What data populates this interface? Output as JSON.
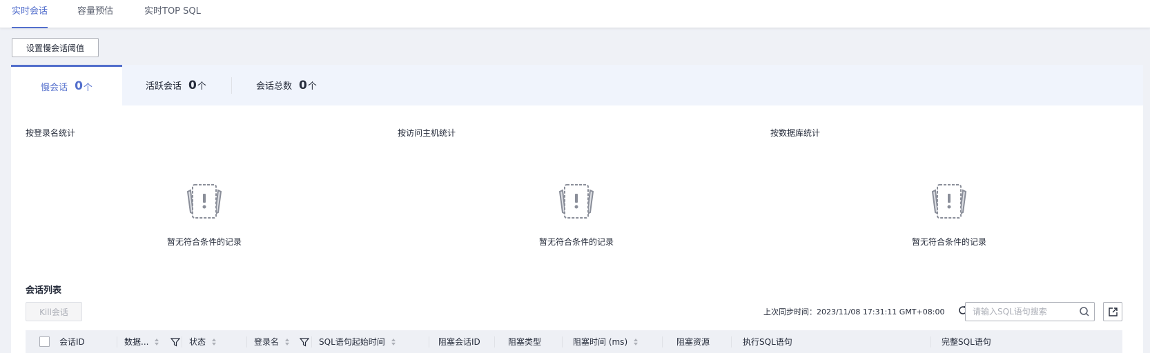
{
  "top_tabs": [
    {
      "label": "实时会话"
    },
    {
      "label": "容量预估"
    },
    {
      "label": "实时TOP SQL"
    }
  ],
  "threshold_button": "设置慢会话阈值",
  "stats": [
    {
      "label": "慢会话",
      "value": "0",
      "unit": "个"
    },
    {
      "label": "活跃会话",
      "value": "0",
      "unit": "个"
    },
    {
      "label": "会话总数",
      "value": "0",
      "unit": "个"
    }
  ],
  "breakdowns": [
    {
      "title": "按登录名统计",
      "empty_text": "暂无符合条件的记录"
    },
    {
      "title": "按访问主机统计",
      "empty_text": "暂无符合条件的记录"
    },
    {
      "title": "按数据库统计",
      "empty_text": "暂无符合条件的记录"
    }
  ],
  "session_list": {
    "title": "会话列表",
    "kill_button": "Kill会话",
    "sync_label": "上次同步时间：",
    "sync_time": "2023/11/08 17:31:11 GMT+08:00",
    "search_placeholder": "请输入SQL语句搜索",
    "columns": [
      {
        "label": "会话ID"
      },
      {
        "label": "数据..."
      },
      {
        "label": "状态"
      },
      {
        "label": "登录名"
      },
      {
        "label": "SQL语句起始时间"
      },
      {
        "label": "阻塞会话ID"
      },
      {
        "label": "阻塞类型"
      },
      {
        "label": "阻塞时间 (ms)"
      },
      {
        "label": "阻塞资源"
      },
      {
        "label": "执行SQL语句"
      },
      {
        "label": "完整SQL语句"
      }
    ]
  },
  "colors": {
    "accent": "#526ecc",
    "text": "#252b3a",
    "header_bg": "#eef0f5"
  }
}
